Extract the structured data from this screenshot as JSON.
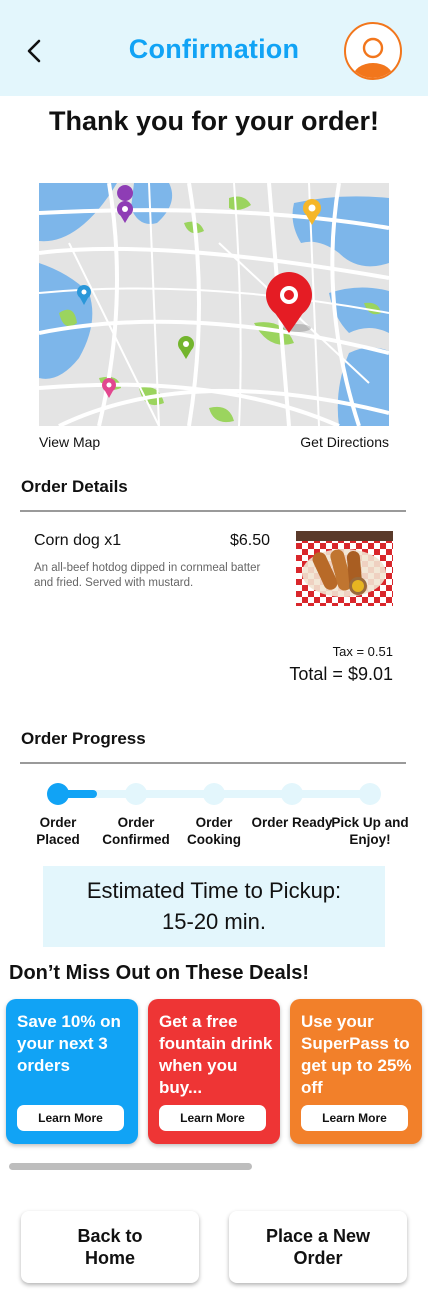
{
  "header": {
    "title": "Confirmation",
    "back_icon": "chevron-left-icon",
    "profile_icon": "user-avatar-icon"
  },
  "thank_you": "Thank you for your order!",
  "map": {
    "view_map": "View Map",
    "get_directions": "Get Directions"
  },
  "order_details": {
    "title": "Order Details",
    "item": {
      "name": "Corn dog x1",
      "price": "$6.50",
      "description": "An all-beef hotdog dipped in cornmeal batter and fried. Served with mustard."
    },
    "tax": "Tax = 0.51",
    "total": "Total = $9.01"
  },
  "order_progress": {
    "title": "Order Progress",
    "completed_fraction": 0.1,
    "steps": [
      {
        "label": "Order Placed",
        "done": true
      },
      {
        "label": "Order Confirmed",
        "done": false
      },
      {
        "label": "Order Cooking",
        "done": false
      },
      {
        "label": "Order Ready",
        "done": false
      },
      {
        "label": "Pick Up and Enjoy!",
        "done": false
      }
    ]
  },
  "eta": {
    "line1": "Estimated Time to Pickup:",
    "line2": "15-20 min."
  },
  "deals": {
    "title": "Don’t Miss Out on These Deals!",
    "cards": [
      {
        "text": "Save 10% on your next 3 orders",
        "button": "Learn More",
        "color": "#11a3f5"
      },
      {
        "text": "Get a free fountain drink when you buy...",
        "button": "Learn More",
        "color": "#ee3535"
      },
      {
        "text": "Use your SuperPass to get up to 25% off",
        "button": "Learn More",
        "color": "#f2802a"
      }
    ]
  },
  "actions": {
    "back_to_home": "Back to Home",
    "place_new_order": "Place a New Order"
  },
  "colors": {
    "accent_blue": "#11a3f5",
    "light_blue": "#e3f6fc",
    "red": "#ee3535",
    "orange": "#f2802a"
  }
}
